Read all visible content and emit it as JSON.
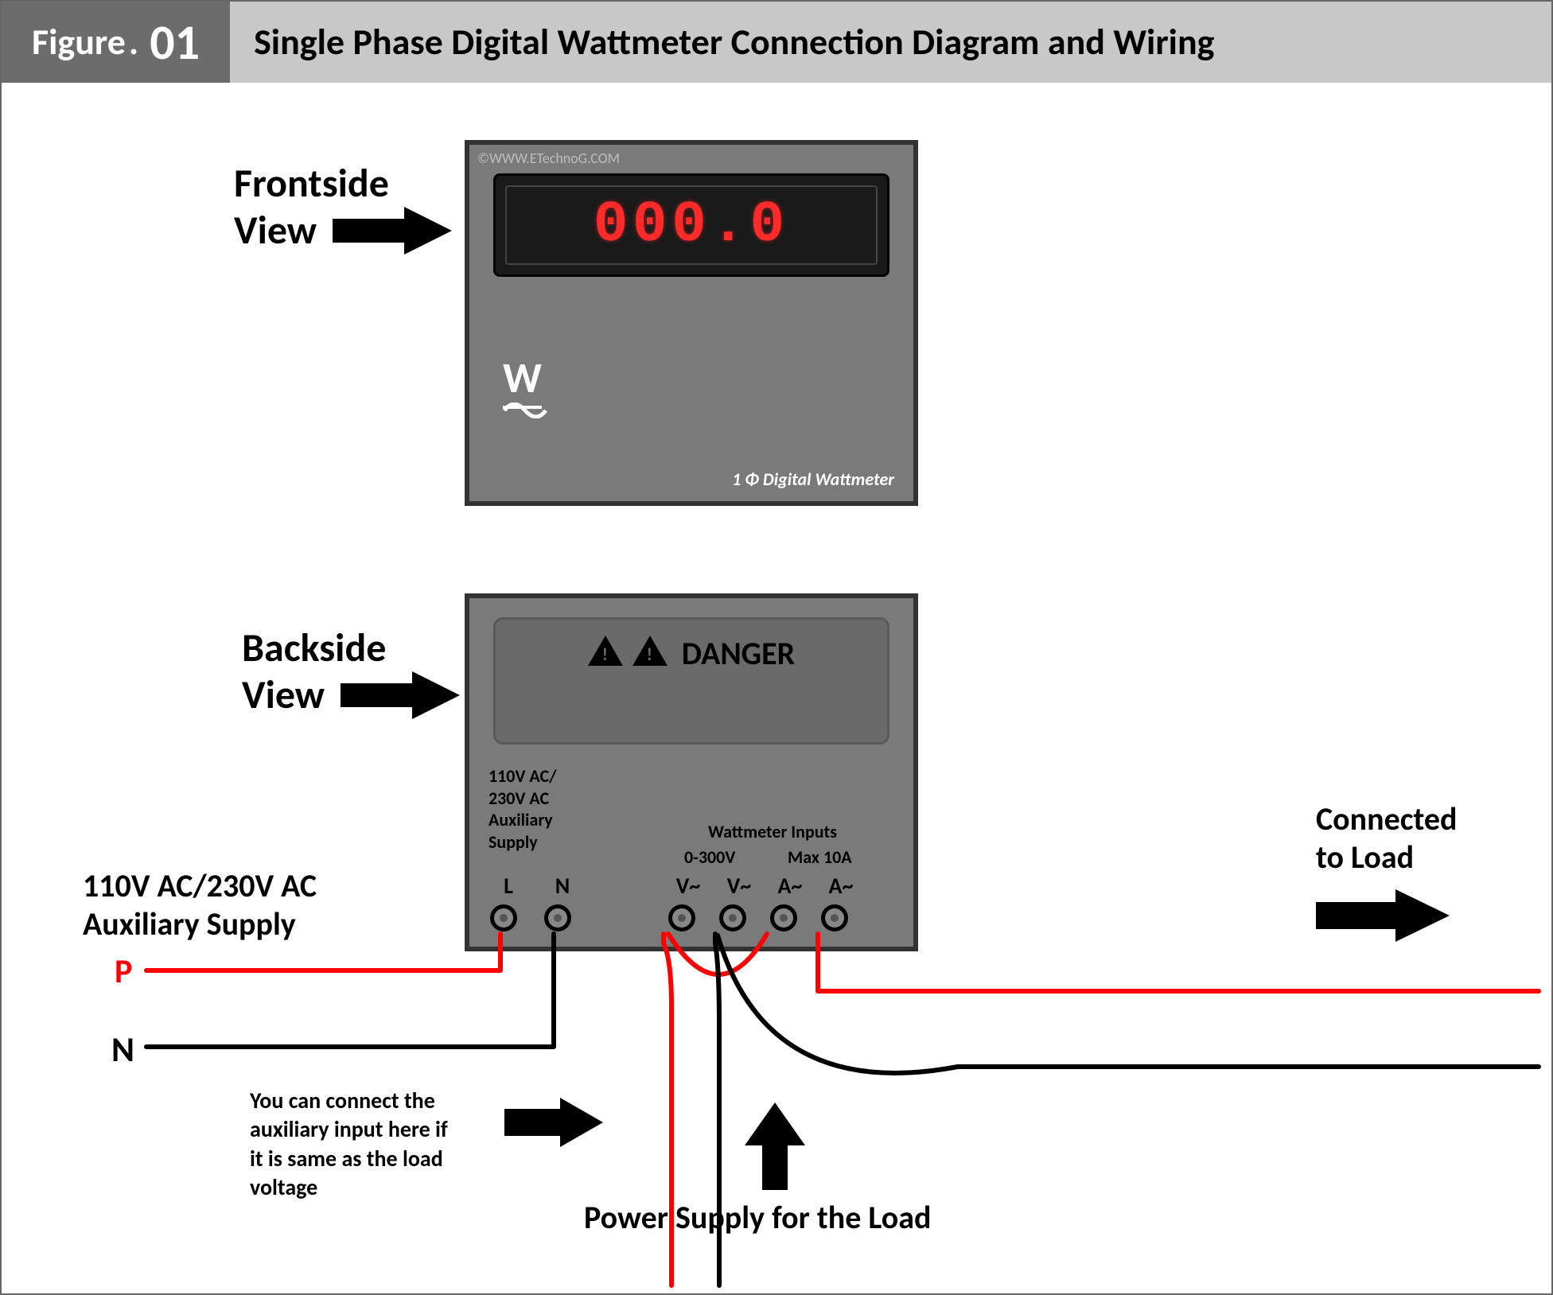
{
  "header": {
    "figure_label_prefix": "Figure",
    "figure_number": "01",
    "title": "Single Phase Digital Wattmeter Connection Diagram and Wiring"
  },
  "front": {
    "label_line1": "Frontside",
    "label_line2": "View",
    "copyright": "©WWW.ETechnoG.COM",
    "display_value": "000.0",
    "unit_mark": "W",
    "description": "1 Φ Digital Wattmeter"
  },
  "back": {
    "label_line1": "Backside",
    "label_line2": "View",
    "danger_text": "DANGER",
    "aux_line1": "110V AC/",
    "aux_line2": "230V AC",
    "aux_line3": "Auxiliary",
    "aux_line4": "Supply",
    "inputs_label": "Wattmeter Inputs",
    "voltage_range": "0-300V",
    "current_range": "Max 10A",
    "terminals": {
      "L": "L",
      "N": "N",
      "V1": "V~",
      "V2": "V~",
      "A1": "A~",
      "A2": "A~"
    }
  },
  "wires": {
    "aux_main_label_line1": "110V AC/230V AC",
    "aux_main_label_line2": "Auxiliary Supply",
    "phase_label": "P",
    "neutral_label": "N",
    "aux_note_line1": "You can connect the",
    "aux_note_line2": "auxiliary input here if",
    "aux_note_line3": "it is same as the load",
    "aux_note_line4": "voltage",
    "power_supply_label": "Power Supply for the Load",
    "load_label_line1": "Connected",
    "load_label_line2": "to Load"
  },
  "colors": {
    "phase": "#ff0000",
    "neutral": "#000000"
  }
}
